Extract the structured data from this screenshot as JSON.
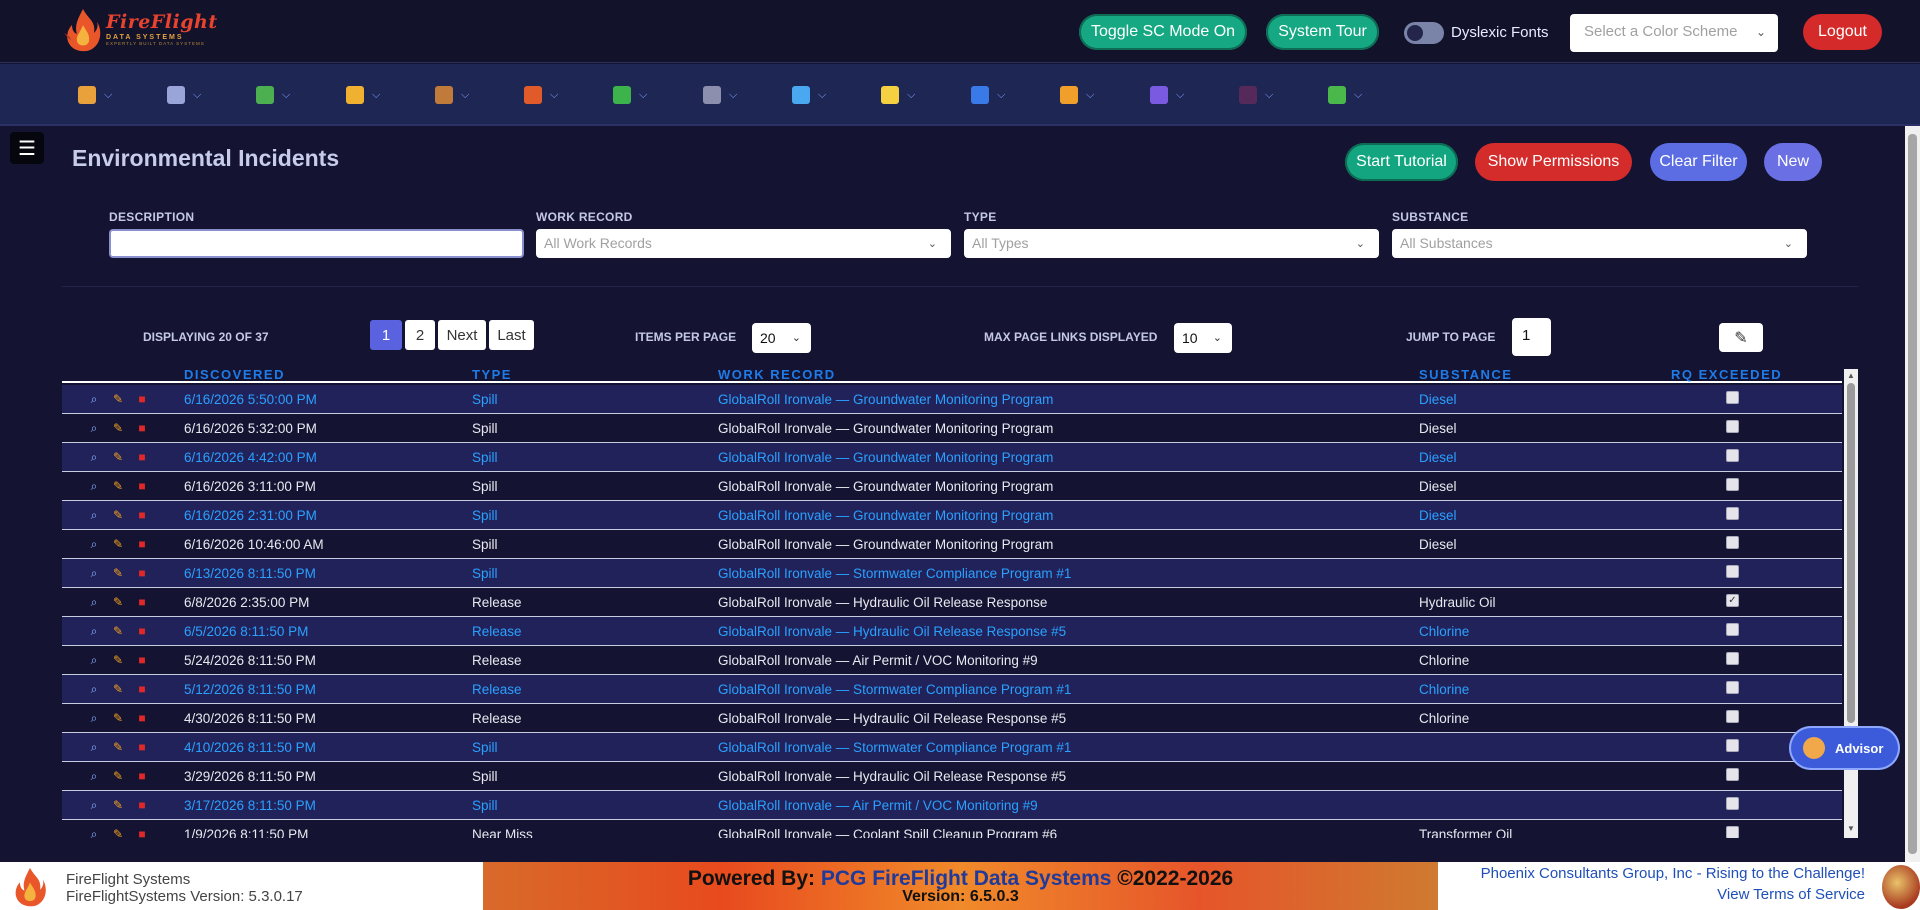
{
  "header": {
    "logo_name": "FireFlight",
    "logo_sub": "DATA SYSTEMS",
    "logo_tag": "EXPERTLY BUILT DATA SYSTEMS",
    "toggle_sc_label": "Toggle SC Mode On",
    "system_tour_label": "System Tour",
    "dyslexic_label": "Dyslexic Fonts",
    "dyslexic_on": false,
    "color_scheme_placeholder": "Select a Color Scheme",
    "logout_label": "Logout"
  },
  "nav": {
    "items": [
      {
        "icon": "home-icon",
        "color": "#e9a23b"
      },
      {
        "icon": "document-icon",
        "color": "#9aa4d8"
      },
      {
        "icon": "puzzle-icon",
        "color": "#4caf50"
      },
      {
        "icon": "truck-icon",
        "color": "#f0b030"
      },
      {
        "icon": "box-icon",
        "color": "#c07a3a"
      },
      {
        "icon": "brick-wall-icon",
        "color": "#e05a2a"
      },
      {
        "icon": "recycle-icon",
        "color": "#3cb44b"
      },
      {
        "icon": "clipboard-icon",
        "color": "#8c8fae"
      },
      {
        "icon": "magnifier-icon",
        "color": "#4aa8f0"
      },
      {
        "icon": "lightbulb-icon",
        "color": "#f5d040"
      },
      {
        "icon": "shield-icon",
        "color": "#3a7ae8"
      },
      {
        "icon": "hand-icon",
        "color": "#f0a02a"
      },
      {
        "icon": "books-icon",
        "color": "#7a5ae0"
      },
      {
        "icon": "graduation-cap-icon",
        "color": "#552a5a"
      },
      {
        "icon": "leaf-icon",
        "color": "#4ab84a"
      }
    ]
  },
  "page": {
    "title": "Environmental Incidents",
    "start_tutorial": "Start Tutorial",
    "show_permissions": "Show Permissions",
    "clear_filter": "Clear Filter",
    "new": "New"
  },
  "filters": {
    "description_label": "DESCRIPTION",
    "description_value": "",
    "work_record_label": "WORK RECORD",
    "work_record_placeholder": "All Work Records",
    "type_label": "TYPE",
    "type_placeholder": "All Types",
    "substance_label": "SUBSTANCE",
    "substance_placeholder": "All Substances"
  },
  "pagination": {
    "displaying": "DISPLAYING 20 OF 37",
    "pages": [
      "1",
      "2"
    ],
    "current_page": "1",
    "next": "Next",
    "last": "Last",
    "items_per_page_label": "ITEMS PER PAGE",
    "items_per_page": "20",
    "max_links_label": "MAX PAGE LINKS DISPLAYED",
    "max_links": "10",
    "jump_label": "JUMP TO PAGE",
    "jump_value": "1"
  },
  "table": {
    "columns": {
      "discovered": "DISCOVERED",
      "type": "TYPE",
      "work_record": "WORK RECORD",
      "substance": "SUBSTANCE",
      "rq_exceeded": "RQ EXCEEDED"
    },
    "rows": [
      {
        "discovered": "6/16/2026 5:50:00 PM",
        "type": "Spill",
        "work_record": "GlobalRoll Ironvale — Groundwater Monitoring Program",
        "substance": "Diesel",
        "rq": false
      },
      {
        "discovered": "6/16/2026 5:32:00 PM",
        "type": "Spill",
        "work_record": "GlobalRoll Ironvale — Groundwater Monitoring Program",
        "substance": "Diesel",
        "rq": false
      },
      {
        "discovered": "6/16/2026 4:42:00 PM",
        "type": "Spill",
        "work_record": "GlobalRoll Ironvale — Groundwater Monitoring Program",
        "substance": "Diesel",
        "rq": false
      },
      {
        "discovered": "6/16/2026 3:11:00 PM",
        "type": "Spill",
        "work_record": "GlobalRoll Ironvale — Groundwater Monitoring Program",
        "substance": "Diesel",
        "rq": false
      },
      {
        "discovered": "6/16/2026 2:31:00 PM",
        "type": "Spill",
        "work_record": "GlobalRoll Ironvale — Groundwater Monitoring Program",
        "substance": "Diesel",
        "rq": false
      },
      {
        "discovered": "6/16/2026 10:46:00 AM",
        "type": "Spill",
        "work_record": "GlobalRoll Ironvale — Groundwater Monitoring Program",
        "substance": "Diesel",
        "rq": false
      },
      {
        "discovered": "6/13/2026 8:11:50 PM",
        "type": "Spill",
        "work_record": "GlobalRoll Ironvale — Stormwater Compliance Program #1",
        "substance": "",
        "rq": false
      },
      {
        "discovered": "6/8/2026 2:35:00 PM",
        "type": "Release",
        "work_record": "GlobalRoll Ironvale — Hydraulic Oil Release Response",
        "substance": "Hydraulic Oil",
        "rq": true
      },
      {
        "discovered": "6/5/2026 8:11:50 PM",
        "type": "Release",
        "work_record": "GlobalRoll Ironvale — Hydraulic Oil Release Response #5",
        "substance": "Chlorine",
        "rq": false
      },
      {
        "discovered": "5/24/2026 8:11:50 PM",
        "type": "Release",
        "work_record": "GlobalRoll Ironvale — Air Permit / VOC Monitoring #9",
        "substance": "Chlorine",
        "rq": false
      },
      {
        "discovered": "5/12/2026 8:11:50 PM",
        "type": "Release",
        "work_record": "GlobalRoll Ironvale — Stormwater Compliance Program #1",
        "substance": "Chlorine",
        "rq": false
      },
      {
        "discovered": "4/30/2026 8:11:50 PM",
        "type": "Release",
        "work_record": "GlobalRoll Ironvale — Hydraulic Oil Release Response #5",
        "substance": "Chlorine",
        "rq": false
      },
      {
        "discovered": "4/10/2026 8:11:50 PM",
        "type": "Spill",
        "work_record": "GlobalRoll Ironvale — Stormwater Compliance Program #1",
        "substance": "",
        "rq": false
      },
      {
        "discovered": "3/29/2026 8:11:50 PM",
        "type": "Spill",
        "work_record": "GlobalRoll Ironvale — Hydraulic Oil Release Response #5",
        "substance": "",
        "rq": false
      },
      {
        "discovered": "3/17/2026 8:11:50 PM",
        "type": "Spill",
        "work_record": "GlobalRoll Ironvale — Air Permit / VOC Monitoring #9",
        "substance": "",
        "rq": false
      },
      {
        "discovered": "1/9/2026 8:11:50 PM",
        "type": "Near Miss",
        "work_record": "GlobalRoll Ironvale — Coolant Spill Cleanup Program #6",
        "substance": "Transformer Oil",
        "rq": false
      }
    ]
  },
  "advisor": {
    "label": "Advisor"
  },
  "footer": {
    "company": "FireFlight Systems",
    "version": "FireFlightSystems Version: 5.3.0.17",
    "powered_prefix": "Powered By: ",
    "powered_name": "PCG FireFlight Data Systems",
    "powered_suffix": " ©2022-2026",
    "banner_version": "Version: 6.5.0.3",
    "tagline": "Phoenix Consultants Group, Inc - Rising to the Challenge!",
    "terms": "View Terms of Service"
  },
  "colors": {
    "background": "#141432",
    "nav": "#1e2654",
    "accent_blue": "#2aa0ff",
    "green_button": "#15a882",
    "red_button": "#d42a2a",
    "purple_button": "#5c6ce2"
  }
}
